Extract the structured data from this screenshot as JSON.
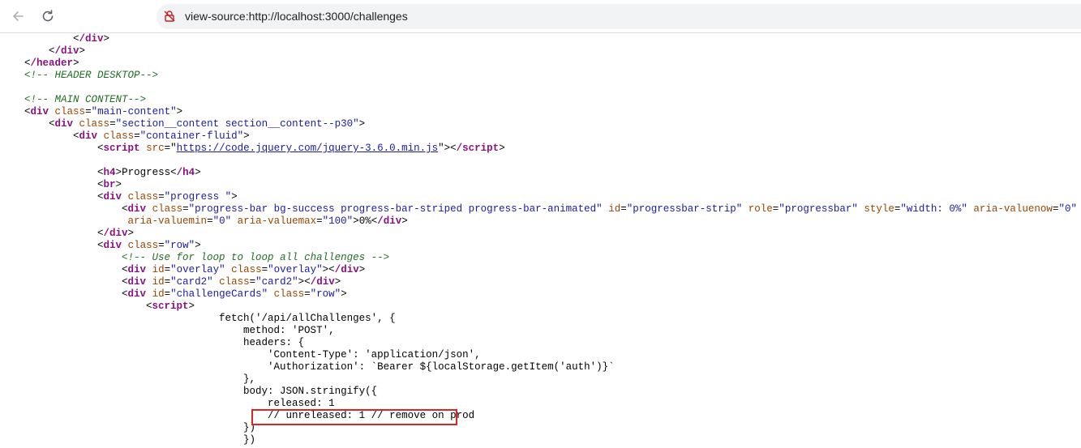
{
  "browser": {
    "address_text": "view-source:http://localhost:3000/challenges"
  },
  "source": {
    "l1_tag": "/div",
    "l2_tag": "/div",
    "l3_tag": "/header",
    "l4_comment": "<!-- HEADER DESKTOP-->",
    "l5_comment": "<!-- MAIN CONTENT-->",
    "l6_tag": "div",
    "l6_attr": "class",
    "l6_val": "\"main-content\"",
    "l7_tag": "div",
    "l7_attr": "class",
    "l7_val": "\"section__content section__content--p30\"",
    "l8_tag": "div",
    "l8_attr": "class",
    "l8_val": "\"container-fluid\"",
    "l9_tag": "script",
    "l9_attr": "src",
    "l9_link": "https://code.jquery.com/jquery-3.6.0.min.js",
    "l9_close": "/script",
    "l10_tag1": "h4",
    "l10_text": "Progress",
    "l10_tag2": "/h4",
    "l11_tag": "br",
    "l12_tag": "div",
    "l12_attr": "class",
    "l12_val": "\"progress \"",
    "l13_tag": "div",
    "l13_attr1": "class",
    "l13_val1": "\"progress-bar bg-success progress-bar-striped progress-bar-animated\"",
    "l13_attr2": "id",
    "l13_val2": "\"progressbar-strip\"",
    "l13_attr3": "role",
    "l13_val3": "\"progressbar\"",
    "l13_attr4": "style",
    "l13_val4": "\"width: 0%\"",
    "l13_attr5": "aria-valuenow",
    "l13_val5": "\"0\"",
    "l14_attr1": "aria-valuemin",
    "l14_val1": "\"0\"",
    "l14_attr2": "aria-valuemax",
    "l14_val2": "\"100\"",
    "l14_text": "0%",
    "l14_close": "/div",
    "l15_tag": "/div",
    "l16_tag": "div",
    "l16_attr": "class",
    "l16_val": "\"row\"",
    "l17_comment": "<!-- Use for loop to loop all challenges -->",
    "l18_tag": "div",
    "l18_attr1": "id",
    "l18_val1": "\"overlay\"",
    "l18_attr2": "class",
    "l18_val2": "\"overlay\"",
    "l18_close": "/div",
    "l19_tag": "div",
    "l19_attr1": "id",
    "l19_val1": "\"card2\"",
    "l19_attr2": "class",
    "l19_val2": "\"card2\"",
    "l19_close": "/div",
    "l20_tag": "div",
    "l20_attr1": "id",
    "l20_val1": "\"challengeCards\"",
    "l20_attr2": "class",
    "l20_val2": "\"row\"",
    "l21_tag": "script",
    "l22": "fetch('/api/allChallenges', {",
    "l23": "method: 'POST',",
    "l24": "headers: {",
    "l25": "'Content-Type': 'application/json',",
    "l26": "'Authorization': `Bearer ${localStorage.getItem('auth')}`",
    "l27": "},",
    "l28": "body: JSON.stringify({",
    "l29": "released: 1",
    "l30": "// unreleased: 1 // remove on prod",
    "l31": "})",
    "l32": "})"
  }
}
